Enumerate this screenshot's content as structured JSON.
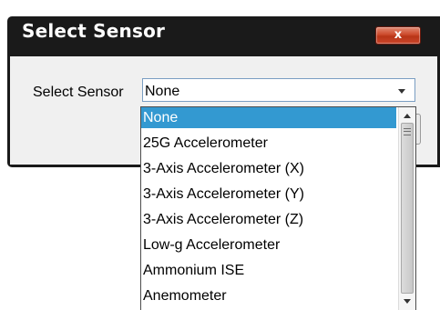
{
  "dialog": {
    "title": "Select Sensor",
    "close_label": "x",
    "colors": {
      "title_bar": "#1a1a1a",
      "close_button": "#c9452a",
      "panel": "#f0f0f0",
      "selection": "#3399d1"
    }
  },
  "form": {
    "label": "Select Sensor",
    "selected_value": "None"
  },
  "dropdown": {
    "options": [
      {
        "label": "None",
        "selected": true
      },
      {
        "label": "25G Accelerometer",
        "selected": false
      },
      {
        "label": "3-Axis Accelerometer (X)",
        "selected": false
      },
      {
        "label": "3-Axis Accelerometer (Y)",
        "selected": false
      },
      {
        "label": "3-Axis Accelerometer (Z)",
        "selected": false
      },
      {
        "label": "Low-g Accelerometer",
        "selected": false
      },
      {
        "label": "Ammonium ISE",
        "selected": false
      },
      {
        "label": "Anemometer",
        "selected": false
      }
    ]
  },
  "icons": {
    "close": "close-icon",
    "dropdown_arrow": "chevron-down-icon",
    "scroll_up": "scroll-up-icon",
    "scroll_down": "scroll-down-icon"
  }
}
